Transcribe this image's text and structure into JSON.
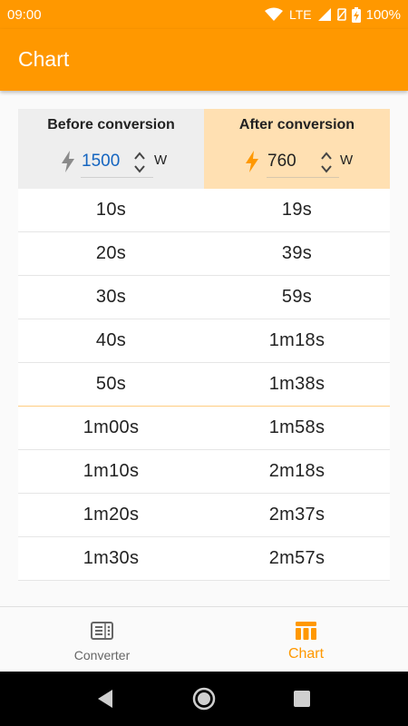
{
  "status": {
    "time": "09:00",
    "network": "LTE",
    "battery": "100%"
  },
  "appbar": {
    "title": "Chart"
  },
  "header": {
    "before": {
      "label": "Before conversion",
      "value": "1500",
      "unit": "W"
    },
    "after": {
      "label": "After conversion",
      "value": "760",
      "unit": "W"
    }
  },
  "rows": [
    {
      "before": "10s",
      "after": "19s"
    },
    {
      "before": "20s",
      "after": "39s"
    },
    {
      "before": "30s",
      "after": "59s"
    },
    {
      "before": "40s",
      "after": "1m18s"
    },
    {
      "before": "50s",
      "after": "1m38s"
    },
    {
      "before": "1m00s",
      "after": "1m58s"
    },
    {
      "before": "1m10s",
      "after": "2m18s"
    },
    {
      "before": "1m20s",
      "after": "2m37s"
    },
    {
      "before": "1m30s",
      "after": "2m57s"
    }
  ],
  "bottom_nav": {
    "items": [
      {
        "label": "Converter",
        "icon": "microwave-icon",
        "active": false
      },
      {
        "label": "Chart",
        "icon": "table-icon",
        "active": true
      }
    ]
  },
  "colors": {
    "primary": "#ff9800",
    "after_bg": "#ffe0b2",
    "before_bg": "#eeeeee",
    "before_value": "#1565c0"
  }
}
